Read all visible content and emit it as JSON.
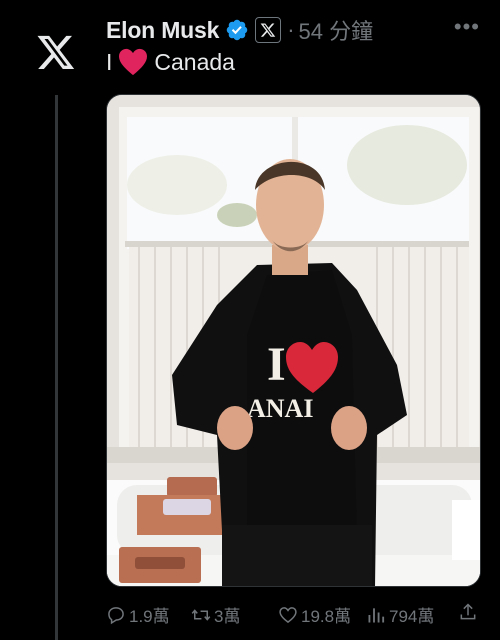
{
  "author": {
    "name": "Elon Musk",
    "time": "54 分鐘"
  },
  "tweet": {
    "text_before": "I",
    "text_after": "Canada",
    "shirt_text_top": "I",
    "shirt_text_bottom": "ANAI"
  },
  "actions": {
    "replies": "1.9萬",
    "retweets": "3萬",
    "likes": "19.8萬",
    "views": "794萬"
  },
  "colors": {
    "background": "#000000",
    "verified": "#1d9bf0",
    "heart": "#e0245e",
    "muted": "#71767b"
  }
}
